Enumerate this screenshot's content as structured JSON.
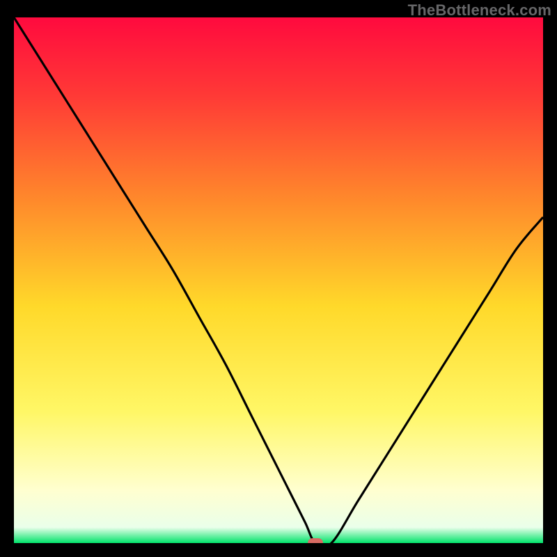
{
  "watermark": "TheBottleneck.com",
  "chart_data": {
    "type": "line",
    "title": "",
    "xlabel": "",
    "ylabel": "",
    "xlim": [
      0,
      100
    ],
    "ylim": [
      0,
      100
    ],
    "gradient_stops": [
      {
        "pct": 0,
        "color": "#ff0a3e"
      },
      {
        "pct": 15,
        "color": "#ff3a36"
      },
      {
        "pct": 35,
        "color": "#ff8a2b"
      },
      {
        "pct": 55,
        "color": "#ffd92a"
      },
      {
        "pct": 75,
        "color": "#fff766"
      },
      {
        "pct": 90,
        "color": "#ffffd0"
      },
      {
        "pct": 97,
        "color": "#eaffea"
      },
      {
        "pct": 100,
        "color": "#00e36a"
      }
    ],
    "series": [
      {
        "name": "bottleneck-curve",
        "x": [
          0,
          5,
          10,
          15,
          20,
          25,
          30,
          35,
          40,
          45,
          50,
          52,
          55,
          57,
          60,
          65,
          70,
          75,
          80,
          85,
          90,
          95,
          100
        ],
        "y": [
          100,
          92,
          84,
          76,
          68,
          60,
          52,
          43,
          34,
          24,
          14,
          10,
          4,
          0,
          0,
          8,
          16,
          24,
          32,
          40,
          48,
          56,
          62
        ]
      }
    ],
    "optimal_point": {
      "x": 57,
      "y": 0,
      "color": "#d76b63"
    }
  }
}
